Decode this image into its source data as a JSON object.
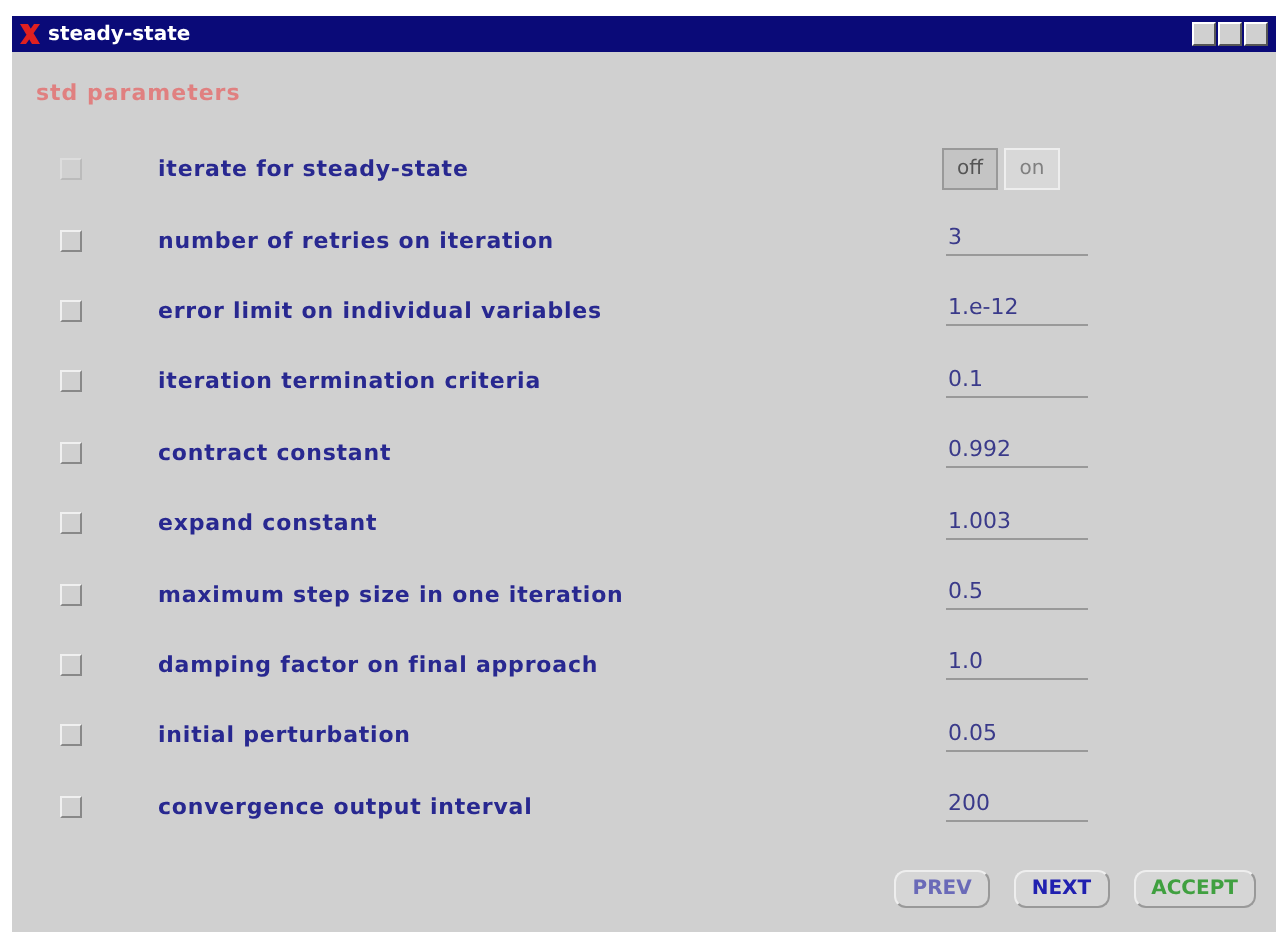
{
  "window": {
    "title": "steady-state"
  },
  "section": "std parameters",
  "params": [
    {
      "kind": "toggle",
      "label": "iterate for steady-state",
      "checked": false,
      "disabled": true,
      "options": [
        {
          "label": "off",
          "selected": true
        },
        {
          "label": "on",
          "selected": false
        }
      ]
    },
    {
      "kind": "field",
      "label": "number of retries on iteration",
      "checked": false,
      "disabled": false,
      "value": "3"
    },
    {
      "kind": "field",
      "label": "error limit on individual variables",
      "checked": false,
      "disabled": false,
      "value": "1.e-12"
    },
    {
      "kind": "field",
      "label": "iteration termination criteria",
      "checked": false,
      "disabled": false,
      "value": "0.1"
    },
    {
      "kind": "field",
      "label": "contract constant",
      "checked": false,
      "disabled": false,
      "value": "0.992"
    },
    {
      "kind": "field",
      "label": "expand constant",
      "checked": false,
      "disabled": false,
      "value": "1.003"
    },
    {
      "kind": "field",
      "label": "maximum step size in one iteration",
      "checked": false,
      "disabled": false,
      "value": "0.5"
    },
    {
      "kind": "field",
      "label": "damping factor on final approach",
      "checked": false,
      "disabled": false,
      "value": "1.0"
    },
    {
      "kind": "field",
      "label": "initial perturbation",
      "checked": false,
      "disabled": false,
      "value": "0.05"
    },
    {
      "kind": "field",
      "label": "convergence output interval",
      "checked": false,
      "disabled": false,
      "value": "200"
    }
  ],
  "buttons": [
    {
      "kind": "prev",
      "label": "PREV",
      "disabled": true
    },
    {
      "kind": "next",
      "label": "NEXT",
      "disabled": false
    },
    {
      "kind": "accept",
      "label": "ACCEPT",
      "disabled": false
    }
  ]
}
